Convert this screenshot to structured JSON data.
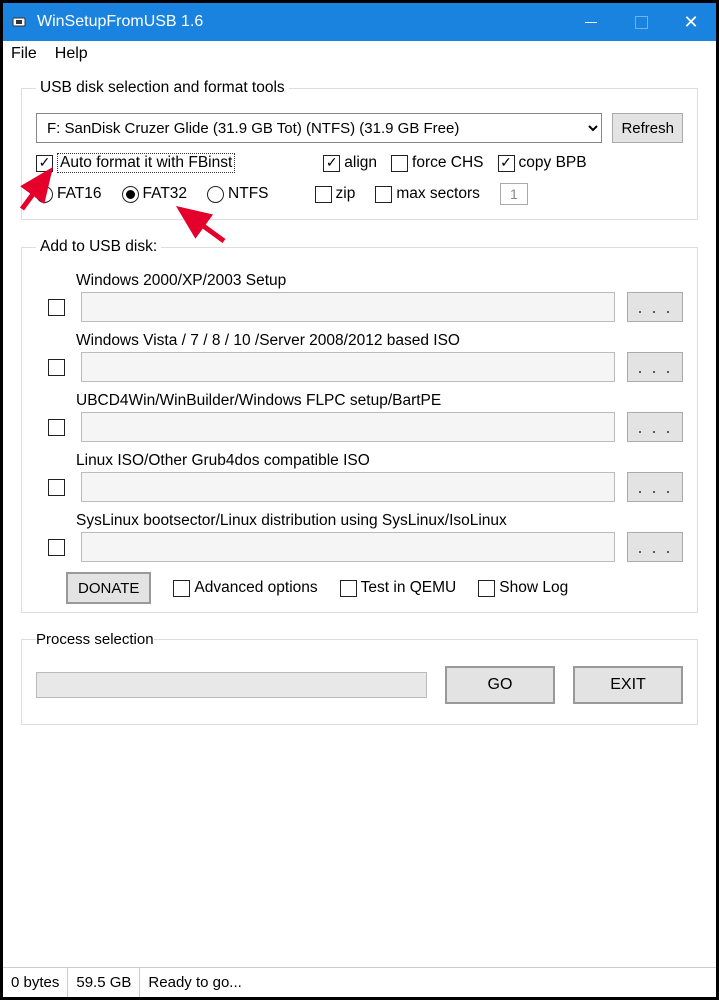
{
  "titlebar": {
    "title": "WinSetupFromUSB 1.6"
  },
  "menu": {
    "file": "File",
    "help": "Help"
  },
  "usb": {
    "legend": "USB disk selection and format tools",
    "selected_disk": "F: SanDisk Cruzer Glide (31.9 GB Tot) (NTFS) (31.9 GB Free)",
    "refresh": "Refresh",
    "autoformat": "Auto format it with FBinst",
    "fat16": "FAT16",
    "fat32": "FAT32",
    "ntfs": "NTFS",
    "align": "align",
    "forcechs": "force CHS",
    "copybpb": "copy BPB",
    "zip": "zip",
    "maxsectors": "max sectors",
    "maxsectors_val": "1"
  },
  "add": {
    "legend": "Add to USB disk:",
    "items": [
      {
        "label": "Windows 2000/XP/2003 Setup"
      },
      {
        "label": "Windows Vista / 7 / 8 / 10 /Server 2008/2012 based ISO"
      },
      {
        "label": "UBCD4Win/WinBuilder/Windows FLPC setup/BartPE"
      },
      {
        "label": "Linux ISO/Other Grub4dos compatible ISO"
      },
      {
        "label": "SysLinux bootsector/Linux distribution using SysLinux/IsoLinux"
      }
    ],
    "browse": ". . ."
  },
  "opts": {
    "donate": "DONATE",
    "advanced": "Advanced options",
    "testqemu": "Test in QEMU",
    "showlog": "Show Log"
  },
  "process": {
    "legend": "Process selection",
    "go": "GO",
    "exit": "EXIT"
  },
  "status": {
    "bytes": "0 bytes",
    "space": "59.5 GB",
    "msg": "Ready to go..."
  }
}
